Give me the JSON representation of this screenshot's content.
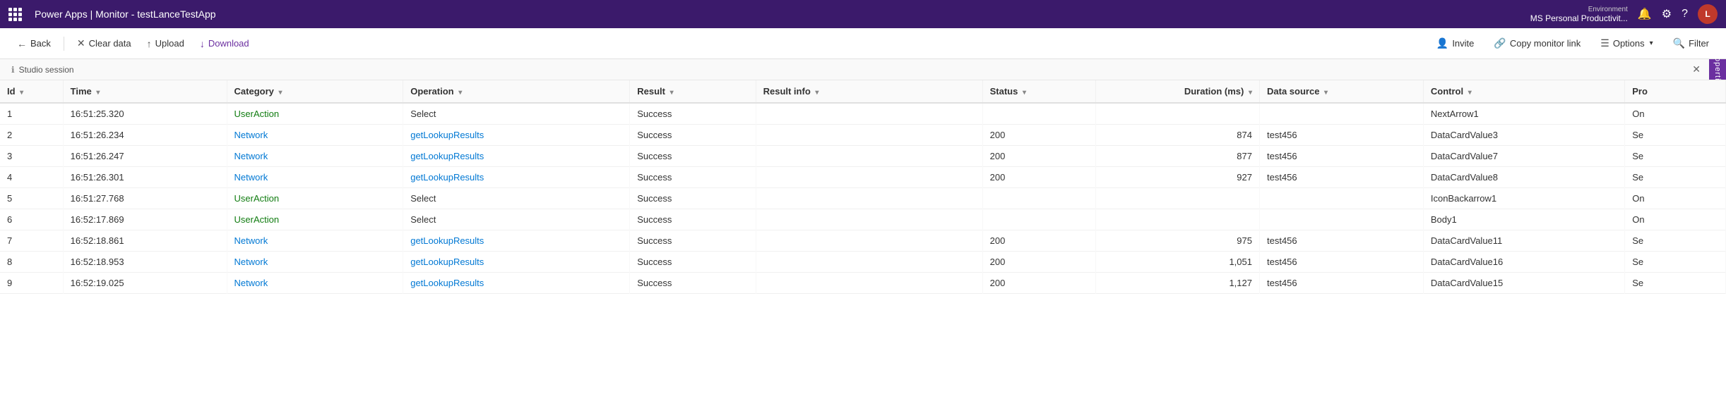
{
  "app": {
    "title": "Power Apps | Monitor - testLanceTestApp"
  },
  "topnav": {
    "title": "Power Apps | Monitor - testLanceTestApp",
    "environment_label": "Environment",
    "environment_name": "MS Personal Productivit...",
    "avatar_initials": "L"
  },
  "toolbar": {
    "back_label": "Back",
    "clear_label": "Clear data",
    "upload_label": "Upload",
    "download_label": "Download",
    "invite_label": "Invite",
    "copy_monitor_label": "Copy monitor link",
    "options_label": "Options",
    "filter_label": "Filter"
  },
  "studio_bar": {
    "label": "Studio session",
    "properties_tab": "Properties"
  },
  "table": {
    "columns": [
      {
        "key": "id",
        "label": "Id",
        "sortable": true
      },
      {
        "key": "time",
        "label": "Time",
        "sortable": true
      },
      {
        "key": "category",
        "label": "Category",
        "sortable": true
      },
      {
        "key": "operation",
        "label": "Operation",
        "sortable": true
      },
      {
        "key": "result",
        "label": "Result",
        "sortable": true
      },
      {
        "key": "result_info",
        "label": "Result info",
        "sortable": true
      },
      {
        "key": "status",
        "label": "Status",
        "sortable": true
      },
      {
        "key": "duration_ms",
        "label": "Duration (ms)",
        "sortable": true
      },
      {
        "key": "data_source",
        "label": "Data source",
        "sortable": true
      },
      {
        "key": "control",
        "label": "Control",
        "sortable": true
      },
      {
        "key": "pro",
        "label": "Pro",
        "sortable": false
      }
    ],
    "rows": [
      {
        "id": 1,
        "time": "16:51:25.320",
        "category": "UserAction",
        "operation": "Select",
        "result": "Success",
        "result_info": "",
        "status": "",
        "duration_ms": "",
        "data_source": "",
        "control": "NextArrow1",
        "pro": "On"
      },
      {
        "id": 2,
        "time": "16:51:26.234",
        "category": "Network",
        "operation": "getLookupResults",
        "result": "Success",
        "result_info": "",
        "status": "200",
        "duration_ms": "874",
        "data_source": "test456",
        "control": "DataCardValue3",
        "pro": "Se"
      },
      {
        "id": 3,
        "time": "16:51:26.247",
        "category": "Network",
        "operation": "getLookupResults",
        "result": "Success",
        "result_info": "",
        "status": "200",
        "duration_ms": "877",
        "data_source": "test456",
        "control": "DataCardValue7",
        "pro": "Se"
      },
      {
        "id": 4,
        "time": "16:51:26.301",
        "category": "Network",
        "operation": "getLookupResults",
        "result": "Success",
        "result_info": "",
        "status": "200",
        "duration_ms": "927",
        "data_source": "test456",
        "control": "DataCardValue8",
        "pro": "Se"
      },
      {
        "id": 5,
        "time": "16:51:27.768",
        "category": "UserAction",
        "operation": "Select",
        "result": "Success",
        "result_info": "",
        "status": "",
        "duration_ms": "",
        "data_source": "",
        "control": "IconBackarrow1",
        "pro": "On"
      },
      {
        "id": 6,
        "time": "16:52:17.869",
        "category": "UserAction",
        "operation": "Select",
        "result": "Success",
        "result_info": "",
        "status": "",
        "duration_ms": "",
        "data_source": "",
        "control": "Body1",
        "pro": "On"
      },
      {
        "id": 7,
        "time": "16:52:18.861",
        "category": "Network",
        "operation": "getLookupResults",
        "result": "Success",
        "result_info": "",
        "status": "200",
        "duration_ms": "975",
        "data_source": "test456",
        "control": "DataCardValue11",
        "pro": "Se"
      },
      {
        "id": 8,
        "time": "16:52:18.953",
        "category": "Network",
        "operation": "getLookupResults",
        "result": "Success",
        "result_info": "",
        "status": "200",
        "duration_ms": "1,051",
        "data_source": "test456",
        "control": "DataCardValue16",
        "pro": "Se"
      },
      {
        "id": 9,
        "time": "16:52:19.025",
        "category": "Network",
        "operation": "getLookupResults",
        "result": "Success",
        "result_info": "",
        "status": "200",
        "duration_ms": "1,127",
        "data_source": "test456",
        "control": "DataCardValue15",
        "pro": "Se"
      }
    ]
  }
}
